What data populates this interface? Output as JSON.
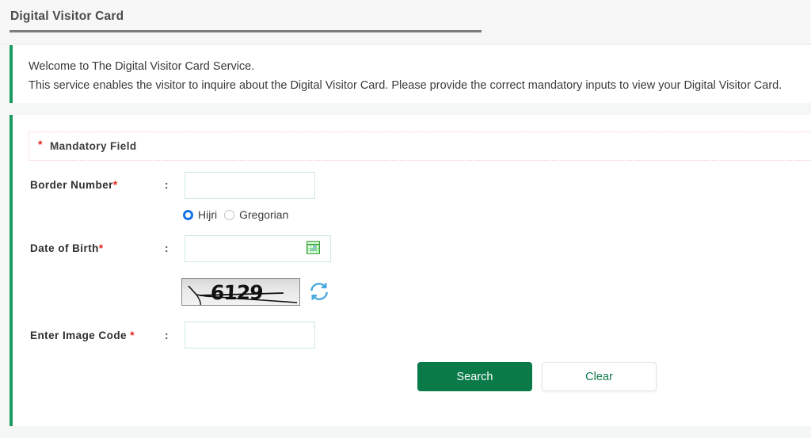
{
  "header": {
    "title": "Digital Visitor Card"
  },
  "welcome": {
    "line1": "Welcome to The Digital Visitor Card Service.",
    "line2": "This service enables the visitor to inquire about the Digital Visitor Card. Please provide the correct mandatory inputs to view your Digital Visitor Card."
  },
  "form": {
    "mandatory_note": {
      "star": "*",
      "label": "Mandatory Field"
    },
    "colon": ":",
    "fields": {
      "border_number": {
        "label": "Border Number",
        "required_mark": "*",
        "value": "",
        "placeholder": ""
      },
      "date_of_birth": {
        "label": "Date of Birth",
        "required_mark": "*",
        "value": "",
        "placeholder": "",
        "calendar_icon": "calendar-icon"
      },
      "image_code": {
        "label": "Enter Image Code",
        "required_mark": "*",
        "value": "",
        "placeholder": ""
      }
    },
    "calendar_type": {
      "options": [
        {
          "label": "Hijri",
          "selected": true
        },
        {
          "label": "Gregorian",
          "selected": false
        }
      ]
    },
    "captcha": {
      "code_text": "6129",
      "refresh_icon": "refresh-icon"
    },
    "buttons": {
      "search": "Search",
      "clear": "Clear"
    }
  },
  "colors": {
    "accent_green": "#1d9b5e",
    "button_green": "#097a48",
    "clear_text_green": "#0f7a4a",
    "required_red": "#e2231a",
    "radio_blue": "#1a73e8",
    "refresh_blue": "#4aa9e0",
    "input_border": "#cfe9de",
    "page_bg": "#f5f6f6"
  }
}
